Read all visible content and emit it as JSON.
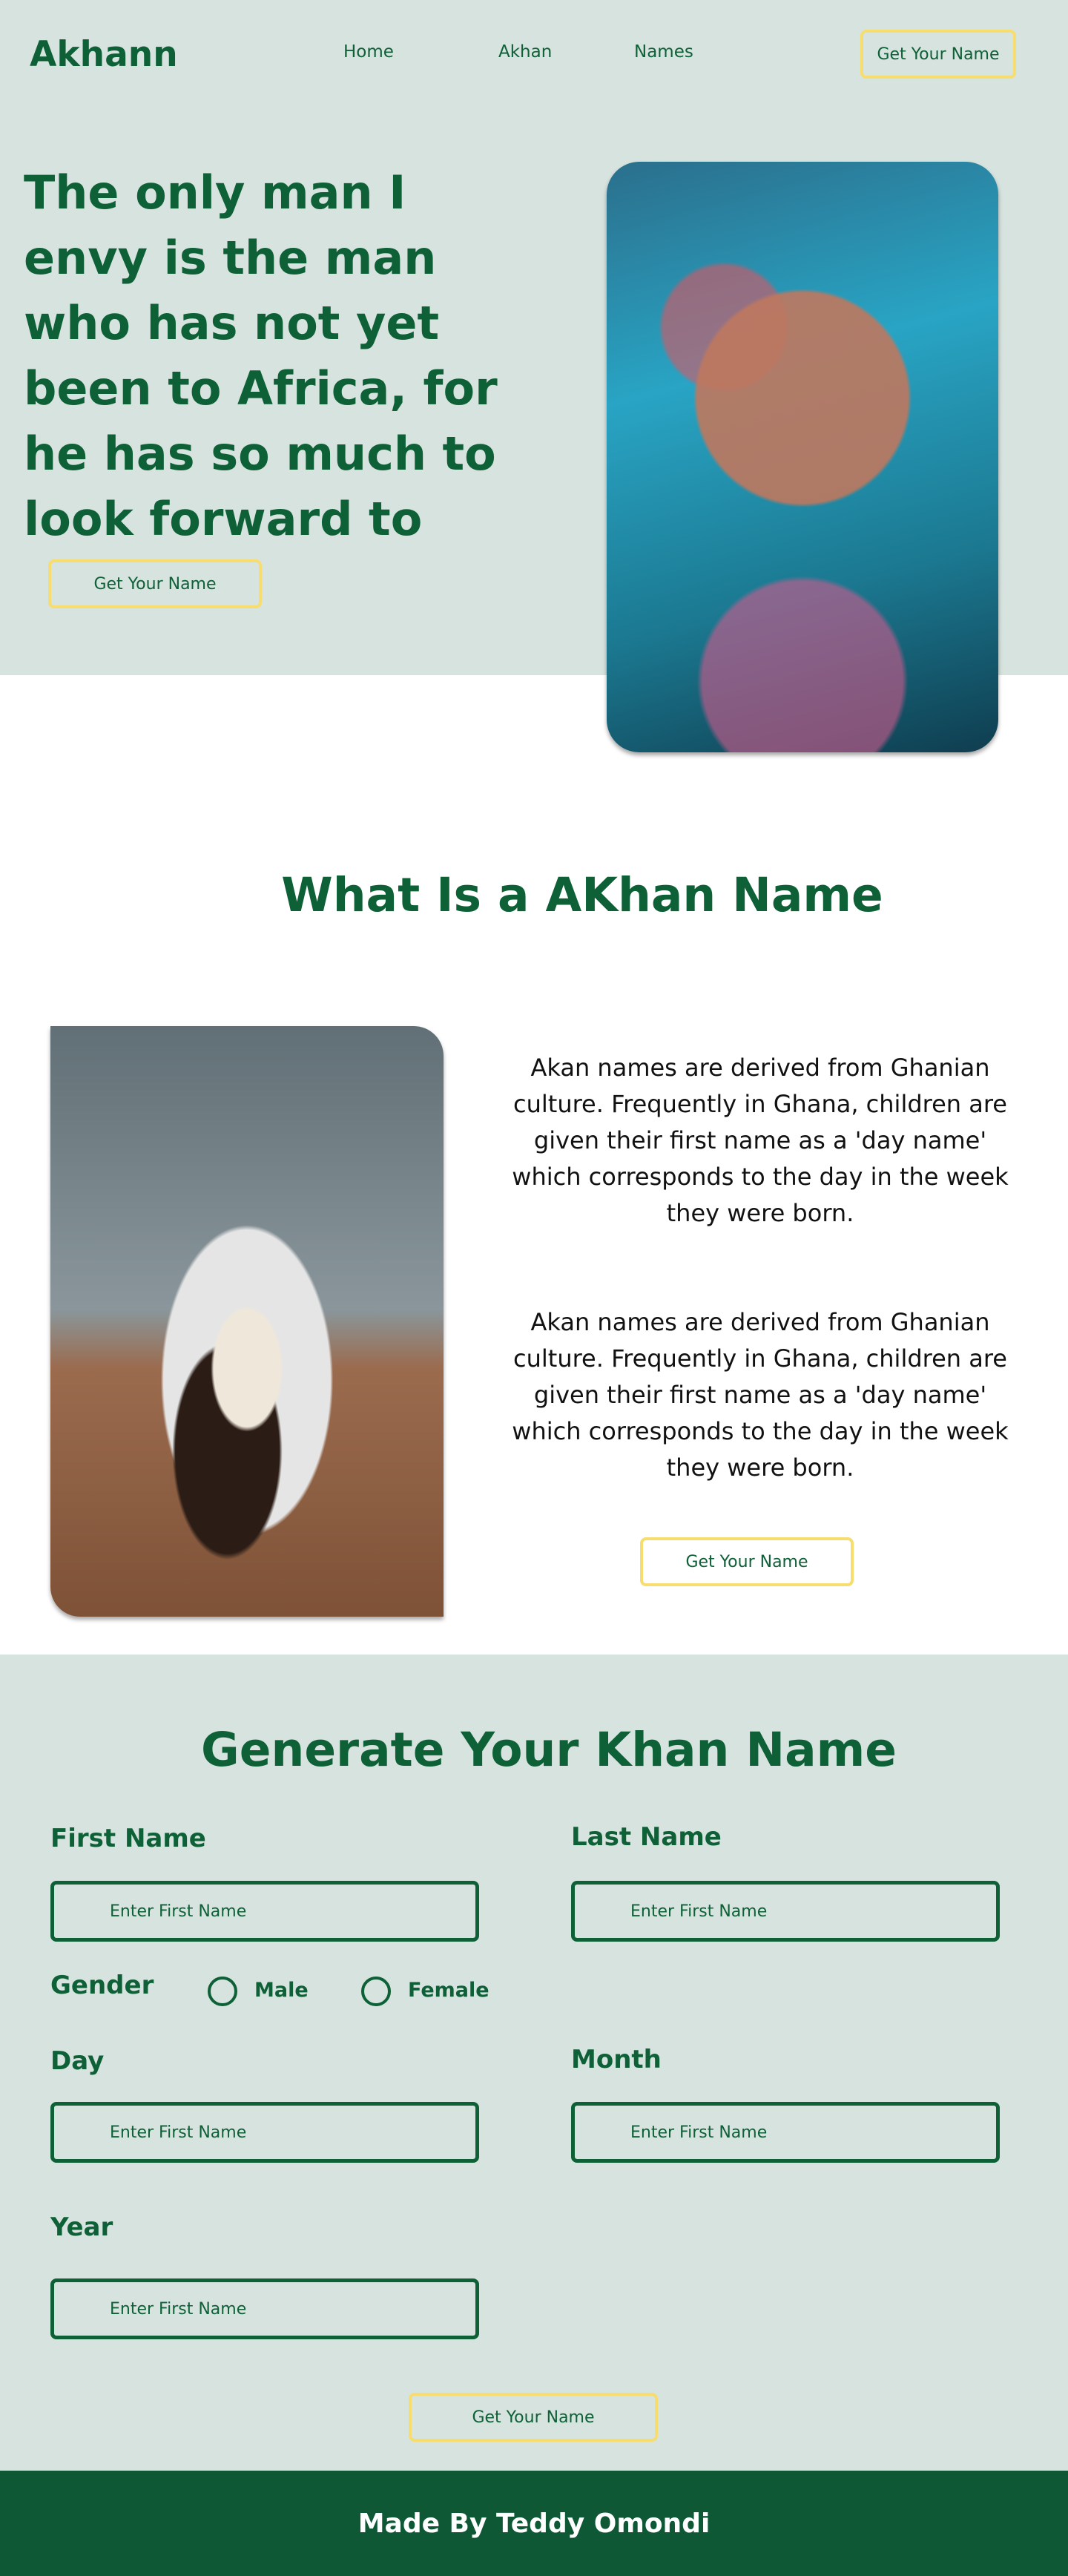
{
  "nav": {
    "logo": "Akhann",
    "links": [
      "Home",
      "Akhan",
      "Names"
    ],
    "cta": "Get Your Name"
  },
  "hero": {
    "headline": "The only man I envy is the man who has not yet been to Africa, for he has so much to look forward to",
    "cta": "Get Your Name"
  },
  "about": {
    "title": "What Is a AKhan Name",
    "paragraphs": [
      "Akan names are derived from Ghanian culture. Frequently in Ghana, children are given their first name as a 'day name' which corresponds to the day in the week they were born.",
      "Akan names are derived from Ghanian culture. Frequently in Ghana, children are given their first name as a 'day name' which corresponds to the day in the week they were born."
    ],
    "cta": "Get Your Name"
  },
  "generator": {
    "title": "Generate Your Khan Name",
    "first_name": {
      "label": "First Name",
      "placeholder": "Enter First Name"
    },
    "last_name": {
      "label": "Last Name",
      "placeholder": "Enter First Name"
    },
    "gender": {
      "label": "Gender",
      "options": [
        "Male",
        "Female"
      ]
    },
    "day": {
      "label": "Day",
      "placeholder": "Enter First Name"
    },
    "month": {
      "label": "Month",
      "placeholder": "Enter First Name"
    },
    "year": {
      "label": "Year",
      "placeholder": "Enter First Name"
    },
    "submit": "Get Your Name"
  },
  "footer": {
    "text": "Made By Teddy Omondi"
  },
  "colors": {
    "brand_green": "#0e6037",
    "mint_bg": "#d6e3df",
    "accent_yellow": "#f7dc6f",
    "footer_bg": "#0e5835"
  }
}
